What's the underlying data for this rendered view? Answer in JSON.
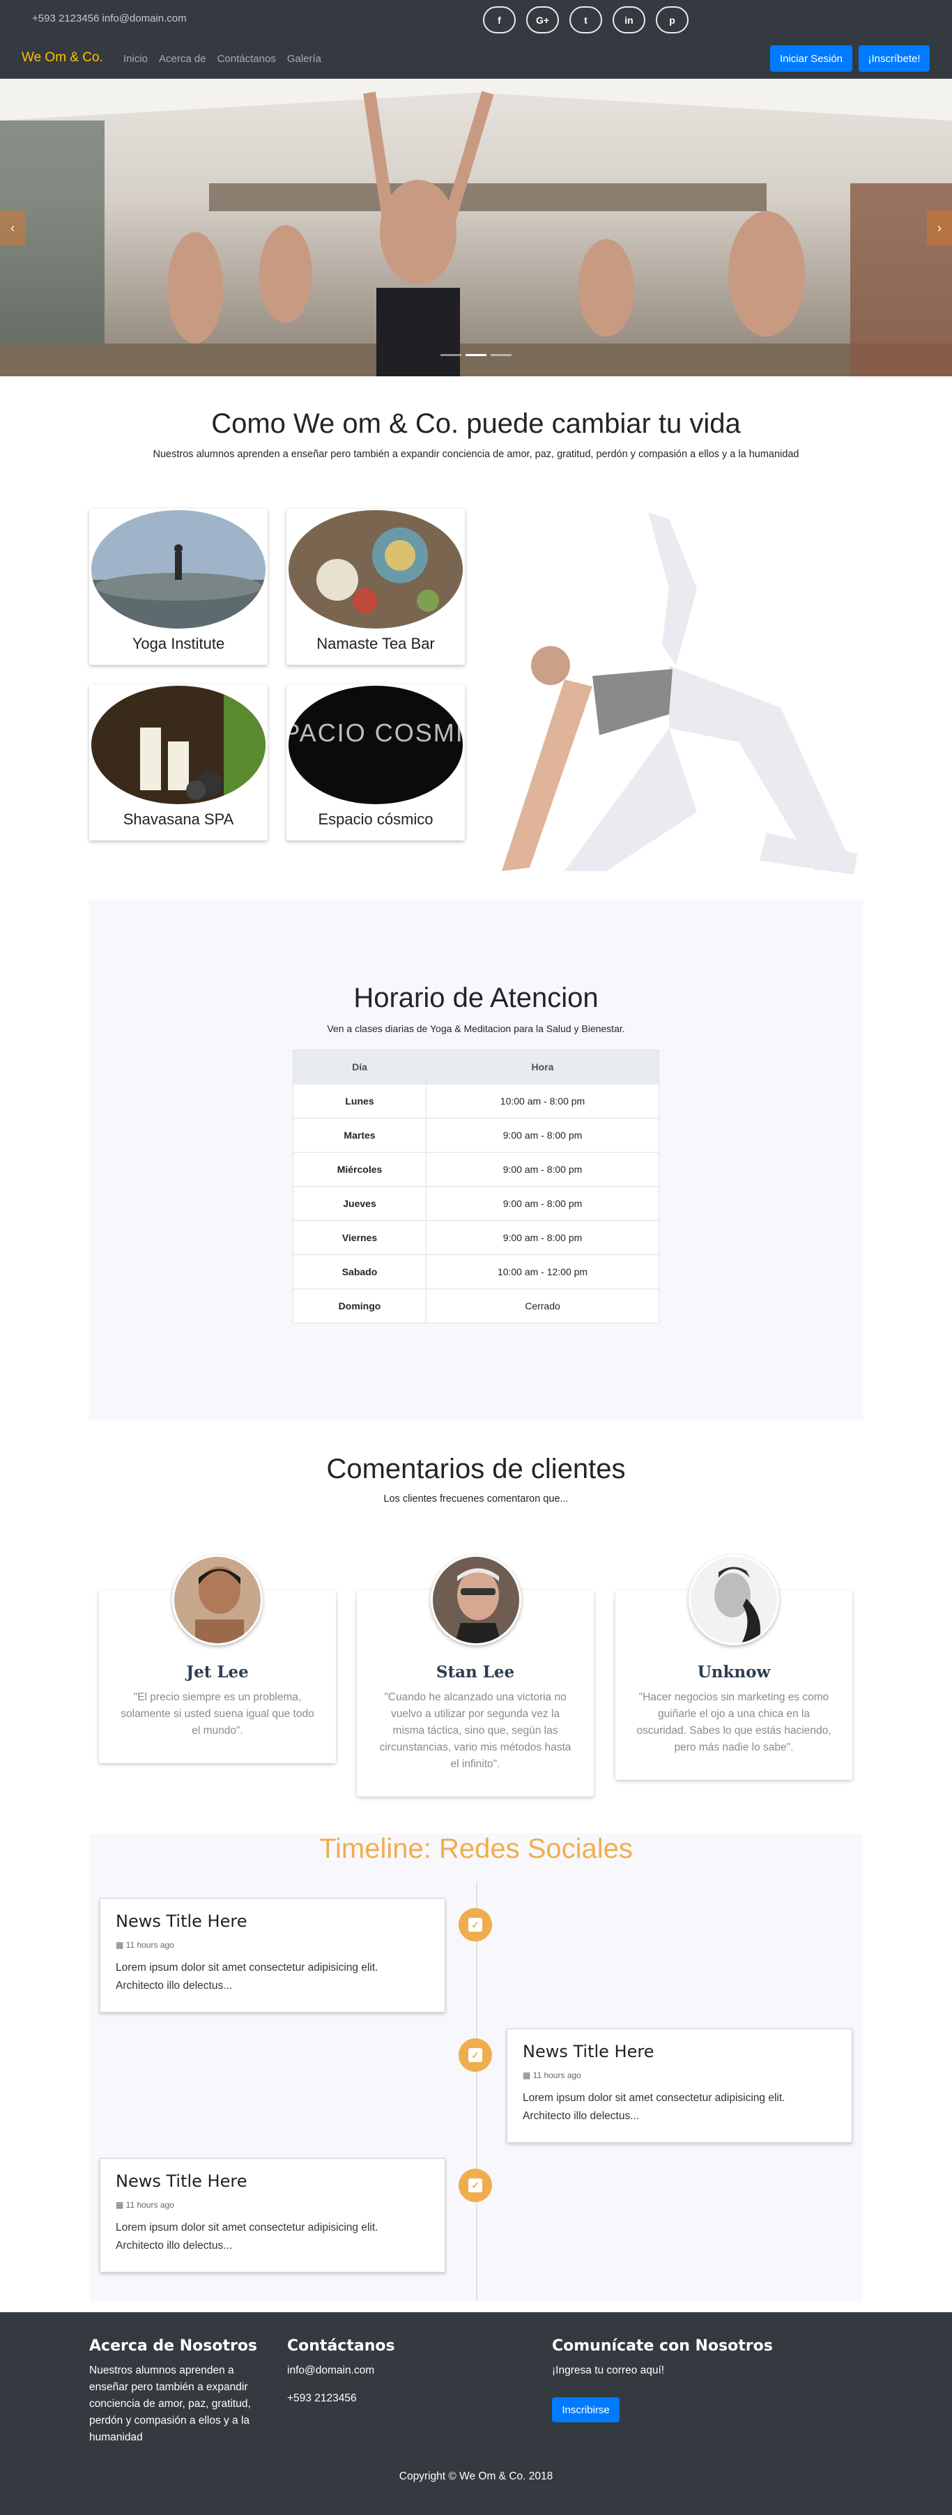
{
  "topbar": {
    "contact": "+593 2123456 info@domain.com",
    "socials": [
      {
        "icon": "facebook-icon",
        "glyph": "f"
      },
      {
        "icon": "google-plus-icon",
        "glyph": "G+"
      },
      {
        "icon": "twitter-icon",
        "glyph": "t"
      },
      {
        "icon": "linkedin-icon",
        "glyph": "in"
      },
      {
        "icon": "pinterest-icon",
        "glyph": "p"
      }
    ]
  },
  "navbar": {
    "brand": "We Om & Co.",
    "links": [
      "Inicio",
      "Acerca de",
      "Contáctanos",
      "Galería"
    ],
    "login": "Iniciar Sesión",
    "signup": "¡Inscríbete!"
  },
  "hero": {
    "prev": "‹",
    "next": "›",
    "slides": 3,
    "active": 2
  },
  "intro": {
    "title": "Como We om & Co. puede cambiar tu vida",
    "subtitle": "Nuestros alumnos aprenden a enseñar pero también a expandir conciencia de amor, paz, gratitud, perdón y compasión a ellos y a la humanidad"
  },
  "services": [
    {
      "label": "Yoga Institute"
    },
    {
      "label": "Namaste Tea Bar"
    },
    {
      "label": "Shavasana SPA"
    },
    {
      "label": "Espacio cósmico",
      "logo_text": "ESPACIO COSMICO"
    }
  ],
  "schedule": {
    "title": "Horario de Atencion",
    "subtitle": "Ven a clases diarias de Yoga & Meditacion para la Salud y Bienestar.",
    "headers": [
      "Día",
      "Hora"
    ],
    "rows": [
      {
        "day": "Lunes",
        "hours": "10:00 am - 8:00 pm"
      },
      {
        "day": "Martes",
        "hours": "9:00 am - 8:00 pm"
      },
      {
        "day": "Miércoles",
        "hours": "9:00 am - 8:00 pm"
      },
      {
        "day": "Jueves",
        "hours": "9:00 am - 8:00 pm"
      },
      {
        "day": "Viernes",
        "hours": "9:00 am - 8:00 pm"
      },
      {
        "day": "Sabado",
        "hours": "10:00 am - 12:00 pm"
      },
      {
        "day": "Domingo",
        "hours": "Cerrado"
      }
    ]
  },
  "testimonials": {
    "title": "Comentarios de clientes",
    "subtitle": "Los clientes frecuenes comentaron que...",
    "items": [
      {
        "name": "Jet Lee",
        "quote": "\"El precio siempre es un problema, solamente si usted suena igual que todo el mundo\"."
      },
      {
        "name": "Stan Lee",
        "quote": "\"Cuando he alcanzado una victoria no vuelvo a utilizar por segunda vez la misma táctica, sino que, según las circunstancias, vario mis métodos hasta el infinito\"."
      },
      {
        "name": "Unknow",
        "quote": "\"Hacer negocios sin marketing es como guiñarle el ojo a una chica en la oscuridad. Sabes lo que estás haciendo, pero más nadie lo sabe\"."
      }
    ]
  },
  "timeline": {
    "title": "Timeline: Redes Sociales",
    "items": [
      {
        "title": "News Title Here",
        "time": "11 hours ago",
        "text": "Lorem ipsum dolor sit amet consectetur adipisicing elit. Architecto illo delectus..."
      },
      {
        "title": "News Title Here",
        "time": "11 hours ago",
        "text": "Lorem ipsum dolor sit amet consectetur adipisicing elit. Architecto illo delectus..."
      },
      {
        "title": "News Title Here",
        "time": "11 hours ago",
        "text": "Lorem ipsum dolor sit amet consectetur adipisicing elit. Architecto illo delectus..."
      }
    ]
  },
  "footer": {
    "about_title": "Acerca de Nosotros",
    "about_text": "Nuestros alumnos aprenden a enseñar pero también a expandir conciencia de amor, paz, gratitud, perdón y compasión a ellos y a la humanidad",
    "contact_title": "Contáctanos",
    "email": "info@domain.com",
    "phone": "+593 2123456",
    "newsletter_title": "Comunícate con Nosotros",
    "newsletter_text": "¡Ingresa tu correo aquí!",
    "subscribe": "Inscribirse",
    "copyright": "Copyright © We Om & Co. 2018"
  }
}
